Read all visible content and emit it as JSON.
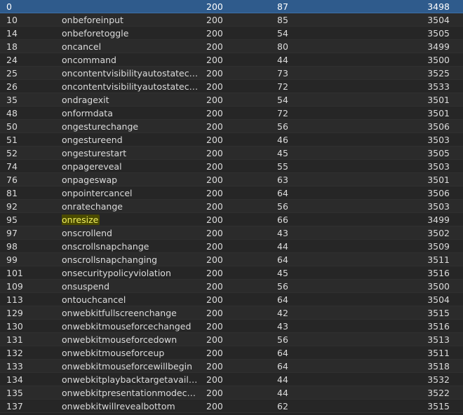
{
  "colors": {
    "background": "#242424",
    "row_alt": "#2b2b2b",
    "selected": "#2f5b8c",
    "highlight_bg": "#4a4a00",
    "highlight_text": "#f0f060"
  },
  "rows": [
    {
      "id": "0",
      "name": "",
      "status": "200",
      "size": "87",
      "time": "3498"
    },
    {
      "id": "10",
      "name": "onbeforeinput",
      "status": "200",
      "size": "85",
      "time": "3504"
    },
    {
      "id": "14",
      "name": "onbeforetoggle",
      "status": "200",
      "size": "54",
      "time": "3505"
    },
    {
      "id": "18",
      "name": "oncancel",
      "status": "200",
      "size": "80",
      "time": "3499"
    },
    {
      "id": "24",
      "name": "oncommand",
      "status": "200",
      "size": "44",
      "time": "3500"
    },
    {
      "id": "25",
      "name": "oncontentvisibilityautostatec…",
      "status": "200",
      "size": "73",
      "time": "3525"
    },
    {
      "id": "26",
      "name": "oncontentvisibilityautostatec…",
      "status": "200",
      "size": "72",
      "time": "3533"
    },
    {
      "id": "35",
      "name": "ondragexit",
      "status": "200",
      "size": "54",
      "time": "3501"
    },
    {
      "id": "48",
      "name": "onformdata",
      "status": "200",
      "size": "72",
      "time": "3501"
    },
    {
      "id": "50",
      "name": "ongesturechange",
      "status": "200",
      "size": "56",
      "time": "3506"
    },
    {
      "id": "51",
      "name": "ongestureend",
      "status": "200",
      "size": "46",
      "time": "3503"
    },
    {
      "id": "52",
      "name": "ongesturestart",
      "status": "200",
      "size": "45",
      "time": "3505"
    },
    {
      "id": "74",
      "name": "onpagereveal",
      "status": "200",
      "size": "55",
      "time": "3503"
    },
    {
      "id": "76",
      "name": "onpageswap",
      "status": "200",
      "size": "63",
      "time": "3501"
    },
    {
      "id": "81",
      "name": "onpointercancel",
      "status": "200",
      "size": "64",
      "time": "3506"
    },
    {
      "id": "92",
      "name": "onratechange",
      "status": "200",
      "size": "56",
      "time": "3503"
    },
    {
      "id": "95",
      "name": "onresize",
      "status": "200",
      "size": "66",
      "time": "3499",
      "highlighted": true
    },
    {
      "id": "97",
      "name": "onscrollend",
      "status": "200",
      "size": "43",
      "time": "3502"
    },
    {
      "id": "98",
      "name": "onscrollsnapchange",
      "status": "200",
      "size": "44",
      "time": "3509"
    },
    {
      "id": "99",
      "name": "onscrollsnapchanging",
      "status": "200",
      "size": "64",
      "time": "3511"
    },
    {
      "id": "101",
      "name": "onsecuritypolicyviolation",
      "status": "200",
      "size": "45",
      "time": "3516"
    },
    {
      "id": "109",
      "name": "onsuspend",
      "status": "200",
      "size": "56",
      "time": "3500"
    },
    {
      "id": "113",
      "name": "ontouchcancel",
      "status": "200",
      "size": "64",
      "time": "3504"
    },
    {
      "id": "129",
      "name": "onwebkitfullscreenchange",
      "status": "200",
      "size": "42",
      "time": "3515"
    },
    {
      "id": "130",
      "name": "onwebkitmouseforcechanged",
      "status": "200",
      "size": "43",
      "time": "3516"
    },
    {
      "id": "131",
      "name": "onwebkitmouseforcedown",
      "status": "200",
      "size": "56",
      "time": "3513"
    },
    {
      "id": "132",
      "name": "onwebkitmouseforceup",
      "status": "200",
      "size": "64",
      "time": "3511"
    },
    {
      "id": "133",
      "name": "onwebkitmouseforcewillbegin",
      "status": "200",
      "size": "64",
      "time": "3518"
    },
    {
      "id": "134",
      "name": "onwebkitplaybacktargetavaila…",
      "status": "200",
      "size": "44",
      "time": "3532"
    },
    {
      "id": "135",
      "name": "onwebkitpresentationmodech…",
      "status": "200",
      "size": "44",
      "time": "3522"
    },
    {
      "id": "137",
      "name": "onwebkitwillrevealbottom",
      "status": "200",
      "size": "62",
      "time": "3515"
    }
  ]
}
